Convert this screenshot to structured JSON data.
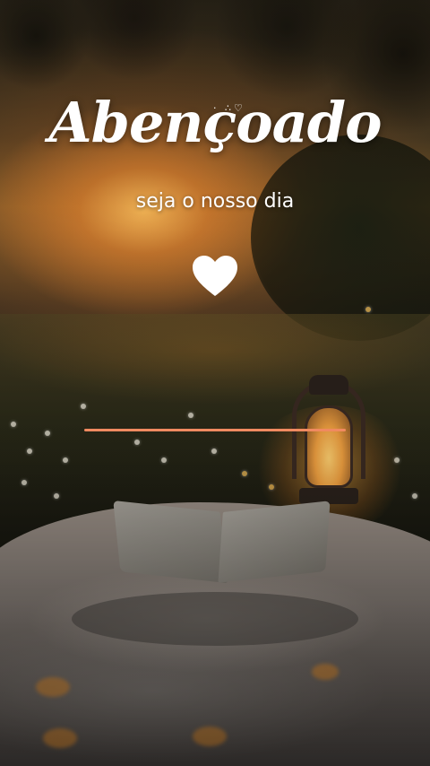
{
  "title": "Abençoado",
  "subtitle": "seja o nosso dia",
  "decoration": {
    "sparkles_glyph": "·  ∴♡",
    "heart_icon": "heart-icon",
    "heart_color": "#ffffff"
  },
  "progress": {
    "value": 1.0,
    "color": "#f08a60"
  },
  "scene": {
    "objects": [
      "sunset",
      "meadow",
      "lantern",
      "open-book",
      "blanket"
    ]
  }
}
